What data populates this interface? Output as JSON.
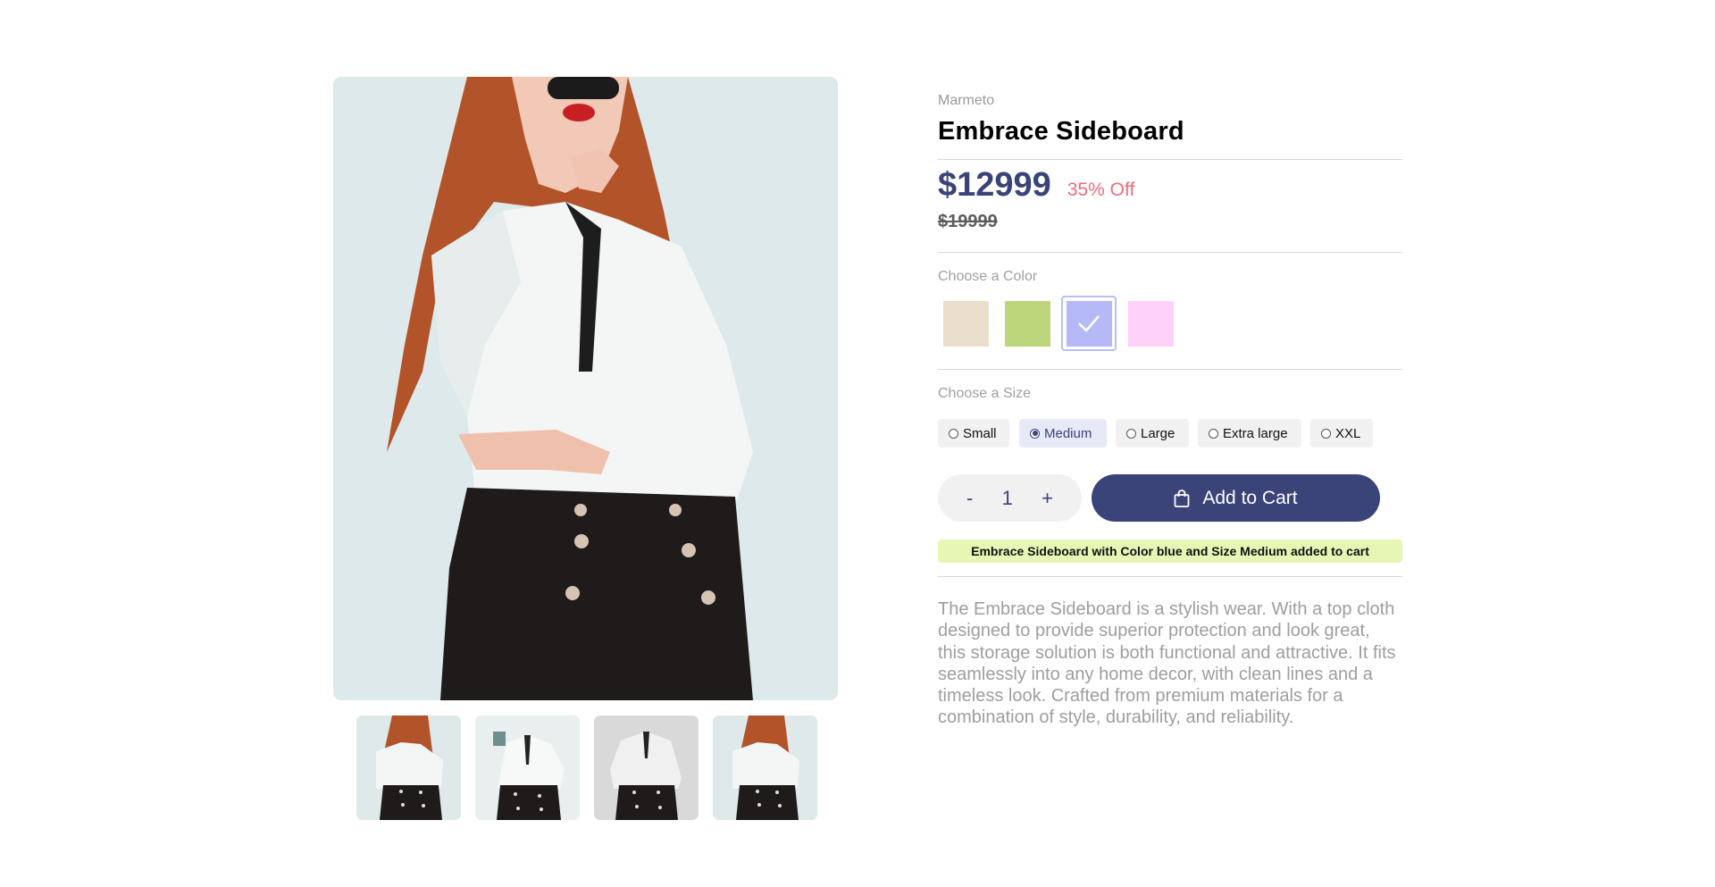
{
  "gallery": {
    "main_image_alt": "Woman in white blouse and black skirt",
    "thumbnails": [
      {
        "alt": "Product view 1"
      },
      {
        "alt": "Product view 2"
      },
      {
        "alt": "Product view 3"
      },
      {
        "alt": "Product view 4"
      }
    ]
  },
  "product": {
    "vendor": "Marmeto",
    "title": "Embrace Sideboard",
    "price": "$12999",
    "discount": "35% Off",
    "compare_at_price": "$19999"
  },
  "color_picker": {
    "label": "Choose a Color",
    "options": [
      {
        "name": "beige",
        "hex": "#ecdecc"
      },
      {
        "name": "green",
        "hex": "#bdd57b"
      },
      {
        "name": "blue",
        "hex": "#b5b9f8",
        "selected": true
      },
      {
        "name": "pink",
        "hex": "#fed1f8"
      }
    ]
  },
  "size_picker": {
    "label": "Choose a Size",
    "options": [
      {
        "label": "Small"
      },
      {
        "label": "Medium",
        "selected": true
      },
      {
        "label": "Large"
      },
      {
        "label": "Extra large"
      },
      {
        "label": "XXL"
      }
    ]
  },
  "quantity": {
    "minus": "-",
    "value": "1",
    "plus": "+"
  },
  "cart": {
    "button_label": "Add to Cart",
    "icon": "shopping-bag-icon"
  },
  "notice": {
    "message": "Embrace Sideboard with Color blue and Size Medium added to cart"
  },
  "description": "The Embrace Sideboard is a stylish wear. With a top cloth designed to provide superior protection and look great, this storage solution is both functional and attractive. It fits seamlessly into any home decor, with clean lines and a timeless look. Crafted from premium materials for a combination of style, durability, and reliability.",
  "colors": {
    "accent": "#3a4479",
    "discount": "#ef6b7c",
    "notice_bg": "#e6f7b5"
  }
}
